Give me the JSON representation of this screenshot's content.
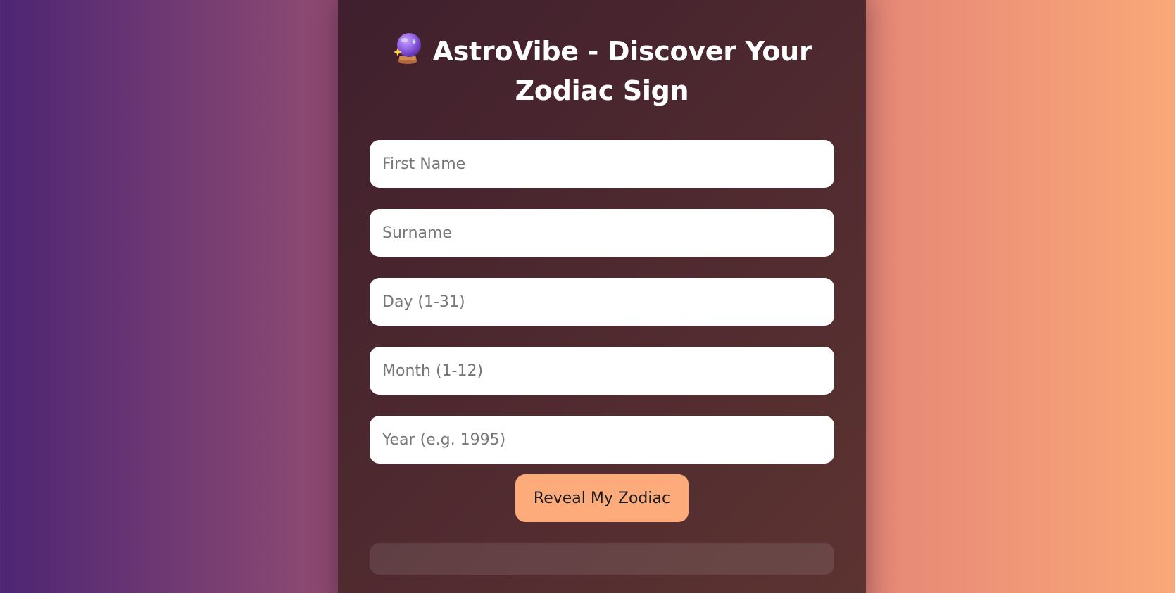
{
  "header": {
    "icon": "crystal-ball-icon",
    "title_line1": "AstroVibe - Discover Your",
    "title_line2": "Zodiac Sign"
  },
  "form": {
    "first_name": {
      "value": "",
      "placeholder": "First Name"
    },
    "surname": {
      "value": "",
      "placeholder": "Surname"
    },
    "day": {
      "value": "",
      "placeholder": "Day (1-31)"
    },
    "month": {
      "value": "",
      "placeholder": "Month (1-12)"
    },
    "year": {
      "value": "",
      "placeholder": "Year (e.g. 1995)"
    },
    "submit_label": "Reveal My Zodiac"
  },
  "result": {
    "text": ""
  },
  "colors": {
    "background_start": "#4d2573",
    "background_end": "#faa879",
    "card": "#4d282f",
    "button": "#fdab7b",
    "input": "#ffffff"
  }
}
